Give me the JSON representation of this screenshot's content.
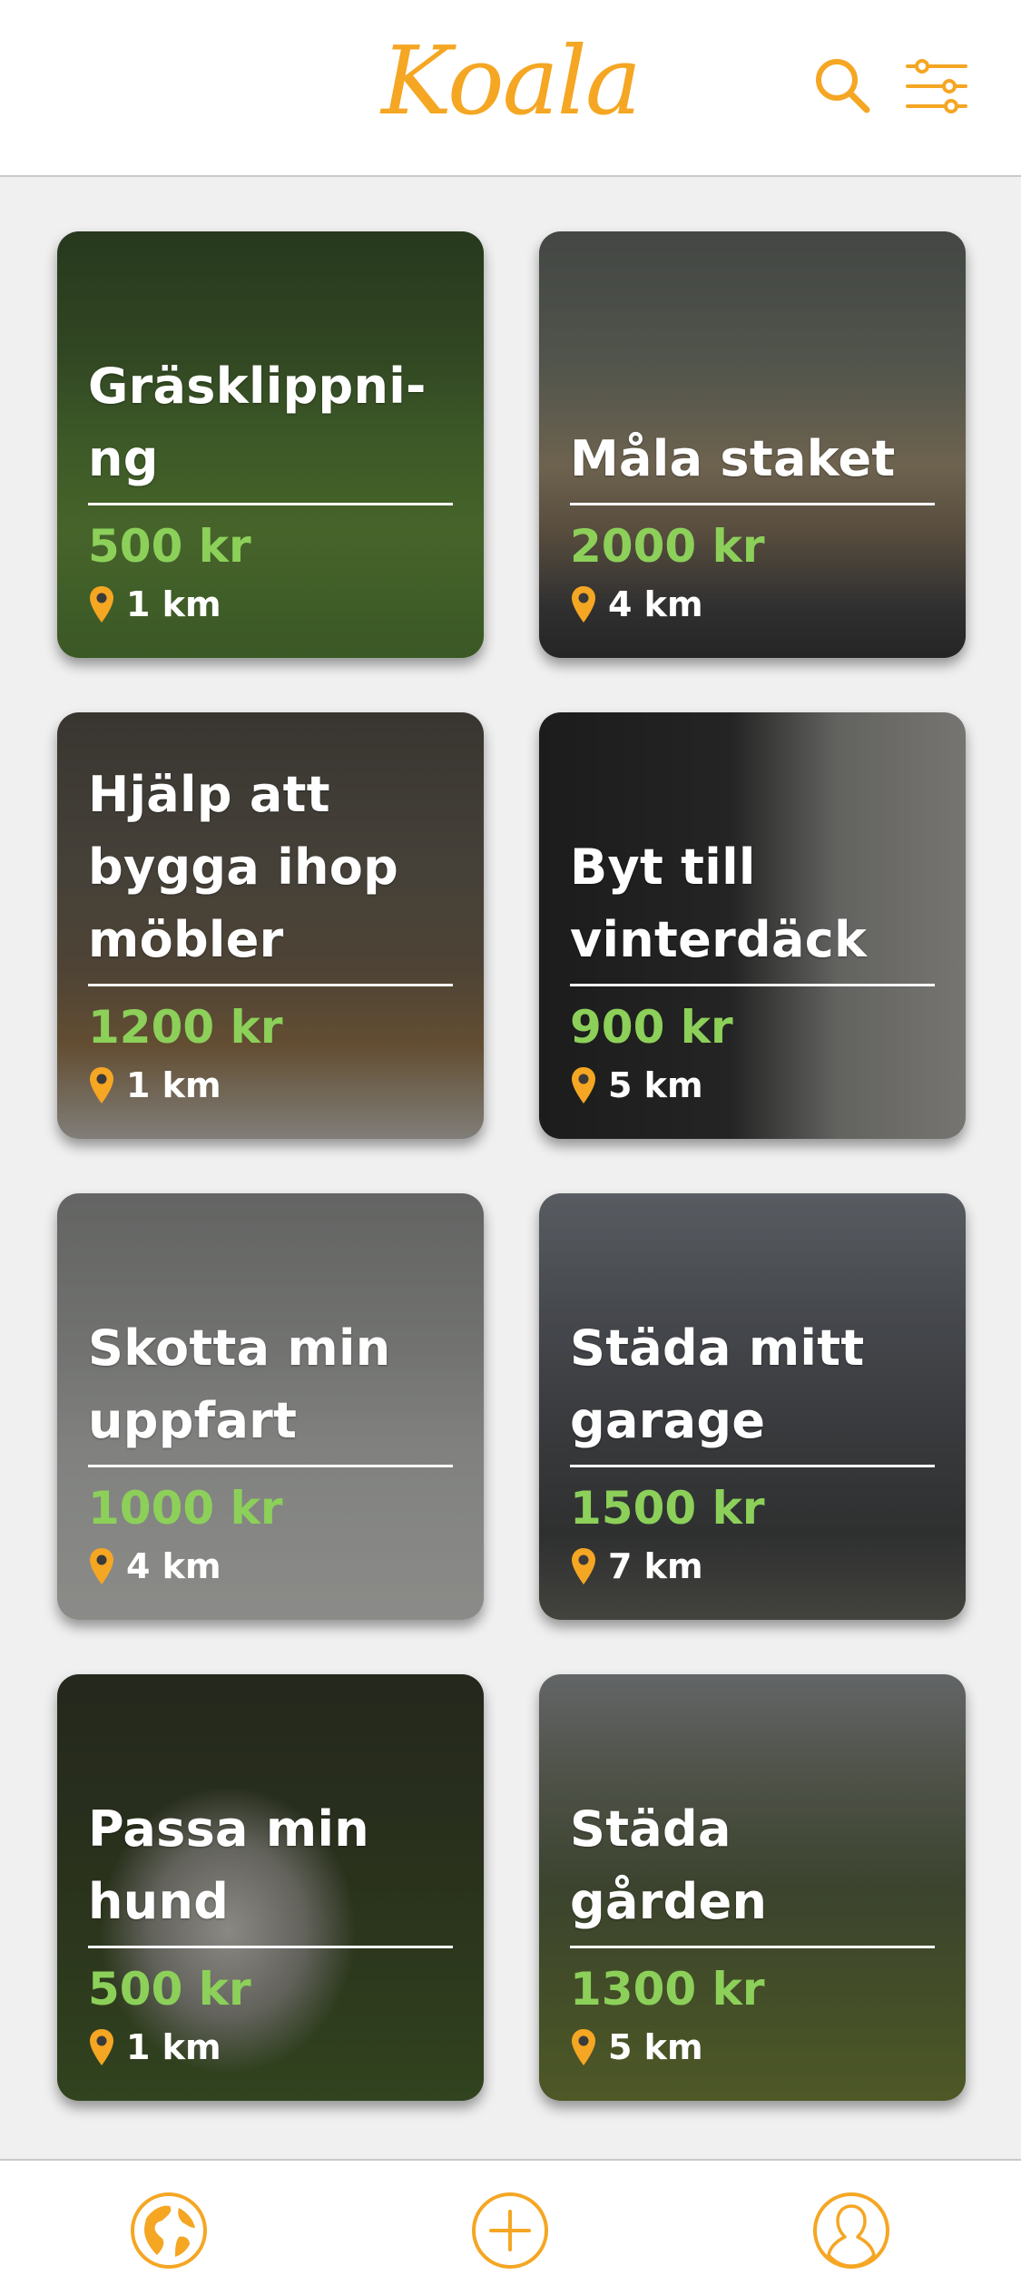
{
  "app": {
    "logo_text": "Koala",
    "accent_color": "#f5a623",
    "price_color": "#8cd05a"
  },
  "header": {
    "search_icon": "search-icon",
    "filter_icon": "sliders-icon"
  },
  "jobs": [
    {
      "title": "Gräsklippni-\nng",
      "price": "500 kr",
      "distance": "1 km",
      "photo": "lawn"
    },
    {
      "title": "Måla staket",
      "price": "2000 kr",
      "distance": "4 km",
      "photo": "fence"
    },
    {
      "title": "Hjälp att\nbygga ihop\nmöbler",
      "price": "1200 kr",
      "distance": "1 km",
      "photo": "room"
    },
    {
      "title": "Byt till\nvinterdäck",
      "price": "900 kr",
      "distance": "5 km",
      "photo": "tires"
    },
    {
      "title": "Skotta min\nuppfart",
      "price": "1000 kr",
      "distance": "4 km",
      "photo": "snow"
    },
    {
      "title": "Städa mitt\ngarage",
      "price": "1500 kr",
      "distance": "7 km",
      "photo": "garage"
    },
    {
      "title": "Passa min\nhund",
      "price": "500 kr",
      "distance": "1 km",
      "photo": "dog"
    },
    {
      "title": "Städa gården",
      "price": "1300 kr",
      "distance": "5 km",
      "photo": "yard"
    }
  ],
  "bottom_nav": [
    {
      "name": "explore",
      "icon": "globe-icon"
    },
    {
      "name": "add",
      "icon": "plus-circle-icon"
    },
    {
      "name": "profile",
      "icon": "user-icon"
    }
  ]
}
